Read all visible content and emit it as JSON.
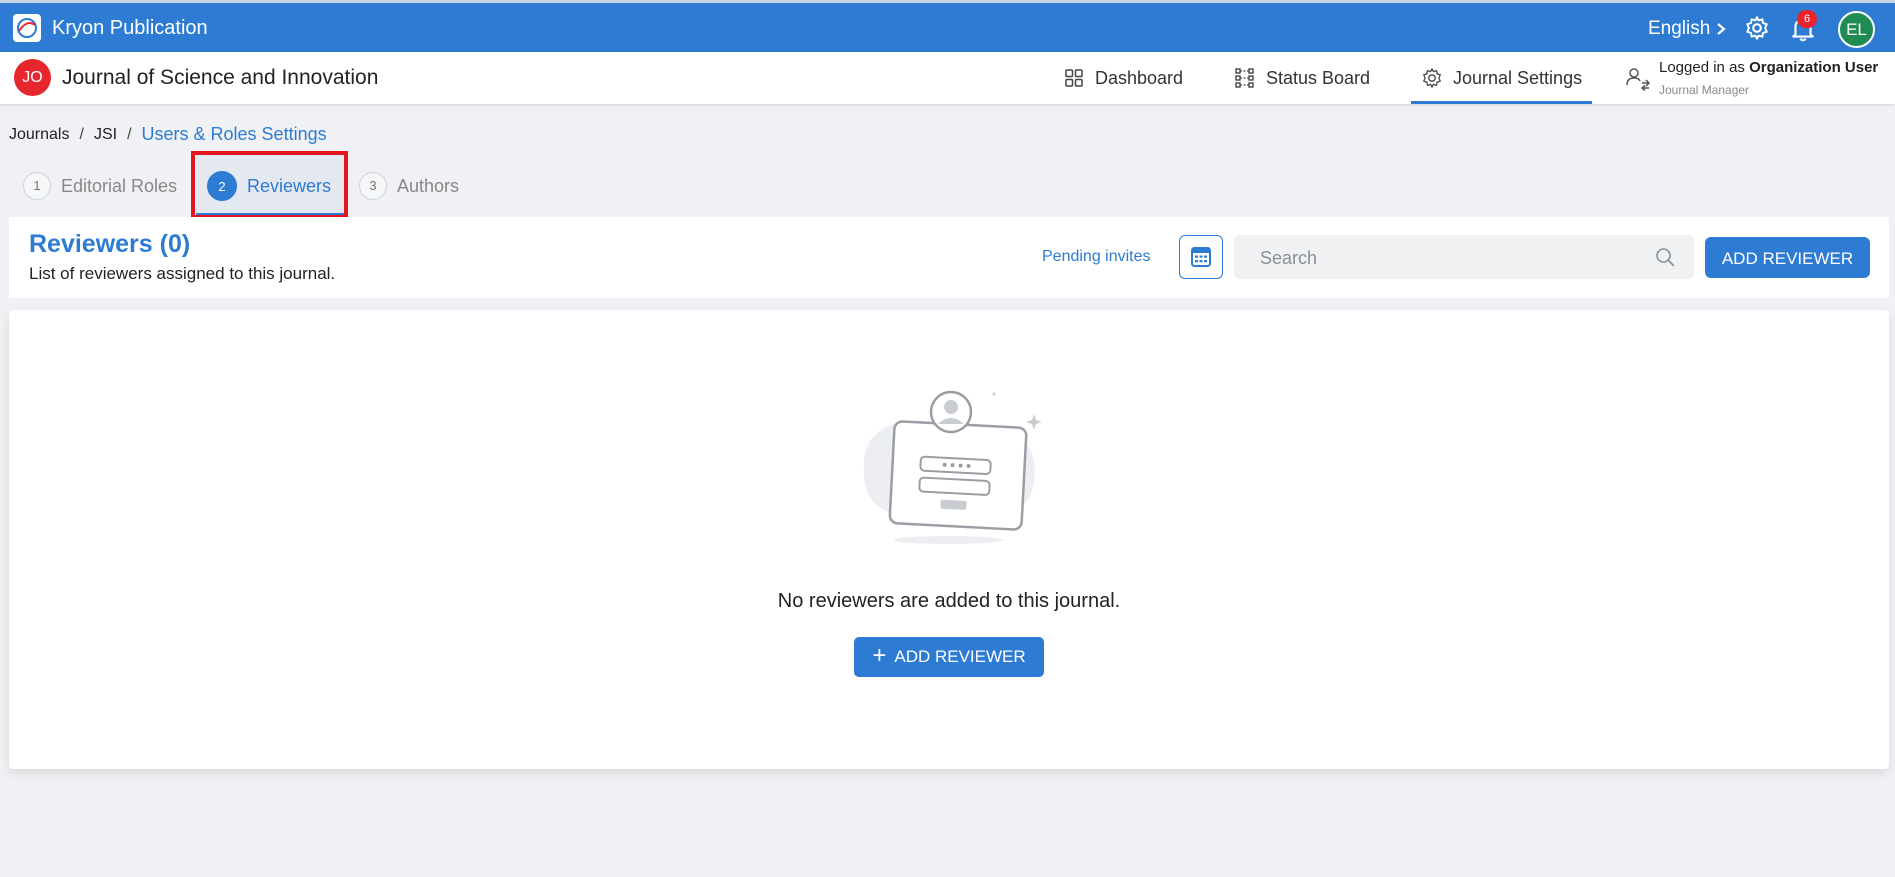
{
  "app": {
    "name": "Kryon Publication"
  },
  "topbar": {
    "language": "English",
    "notification_count": "6",
    "user_initials": "EL"
  },
  "journal": {
    "initials": "JO",
    "title": "Journal of Science and Innovation"
  },
  "nav": {
    "items": [
      {
        "label": "Dashboard",
        "icon": "grid-icon"
      },
      {
        "label": "Status Board",
        "icon": "status-board-icon"
      },
      {
        "label": "Journal Settings",
        "icon": "gear-icon",
        "active": true
      }
    ]
  },
  "user": {
    "logged_in_prefix": "Logged in as ",
    "name": "Organization User",
    "role": "Journal Manager"
  },
  "breadcrumb": {
    "items": [
      "Journals",
      "JSI"
    ],
    "current": "Users & Roles Settings",
    "separator": "/"
  },
  "steps": [
    {
      "number": "1",
      "label": "Editorial Roles"
    },
    {
      "number": "2",
      "label": "Reviewers",
      "active": true
    },
    {
      "number": "3",
      "label": "Authors"
    }
  ],
  "reviewers": {
    "title": "Reviewers (0)",
    "subtitle": "List of reviewers assigned to this journal.",
    "pending_invites": "Pending invites",
    "search_placeholder": "Search",
    "add_button": "ADD REVIEWER",
    "empty_message": "No reviewers are added to this journal.",
    "empty_add_button": "ADD REVIEWER"
  },
  "colors": {
    "primary": "#2d7bd3",
    "highlight": "#e3161f",
    "journal_avatar": "#e8262d",
    "user_avatar": "#1f8c53"
  }
}
